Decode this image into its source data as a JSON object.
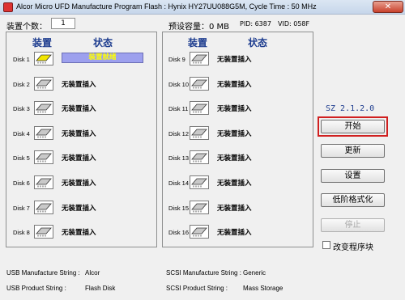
{
  "window": {
    "title": "Alcor Micro UFD Manufacture Program Flash : Hynix HY27UU088G5M, Cycle Time : 50 MHz",
    "close_glyph": "✕"
  },
  "info": {
    "device_count_label": "装置个数：",
    "device_count": "1",
    "preset_capacity": "预设容量：0 MB",
    "pid": "PID: 6387",
    "vid": "VID: 058F"
  },
  "panels": {
    "device_header": "装置",
    "status_header": "状态"
  },
  "disks": [
    {
      "label": "Disk 1",
      "status": "装置就绪"
    },
    {
      "label": "Disk 2",
      "status": "无装置插入"
    },
    {
      "label": "Disk 3",
      "status": "无装置插入"
    },
    {
      "label": "Disk 4",
      "status": "无装置插入"
    },
    {
      "label": "Disk 5",
      "status": "无装置插入"
    },
    {
      "label": "Disk 6",
      "status": "无装置插入"
    },
    {
      "label": "Disk 7",
      "status": "无装置插入"
    },
    {
      "label": "Disk 8",
      "status": "无装置插入"
    },
    {
      "label": "Disk 9",
      "status": "无装置插入"
    },
    {
      "label": "Disk 10",
      "status": "无装置插入"
    },
    {
      "label": "Disk 11",
      "status": "无装置插入"
    },
    {
      "label": "Disk 12",
      "status": "无装置插入"
    },
    {
      "label": "Disk 13",
      "status": "无装置插入"
    },
    {
      "label": "Disk 14",
      "status": "无装置插入"
    },
    {
      "label": "Disk 15",
      "status": "无装置插入"
    },
    {
      "label": "Disk 16",
      "status": "无装置插入"
    }
  ],
  "sidebar": {
    "version": "SZ 2.1.2.0",
    "start": "开始",
    "refresh": "更新",
    "settings": "设置",
    "low_format": "低阶格式化",
    "stop": "停止",
    "change_order_label": "改变程序块"
  },
  "footer": {
    "usb_manufacture_label": "USB Manufacture String :",
    "usb_manufacture_value": "Alcor",
    "usb_product_label": "USB Product String :",
    "usb_product_value": "Flash Disk",
    "scsi_manufacture_label": "SCSI Manufacture String :",
    "scsi_manufacture_value": "Generic",
    "scsi_product_label": "SCSI Product String :",
    "scsi_product_value": "Mass Storage"
  },
  "colors": {
    "active_chip": "#f2e600",
    "idle_chip": "#c9c9c9",
    "ready_bar": "#9da0ee",
    "ready_text": "#ffff00",
    "header_blue": "#1e3d8f",
    "highlight_frame": "#d02020"
  },
  "icons": {
    "chip": "flash-chip-icon",
    "app": "app-icon",
    "close": "close-icon"
  }
}
